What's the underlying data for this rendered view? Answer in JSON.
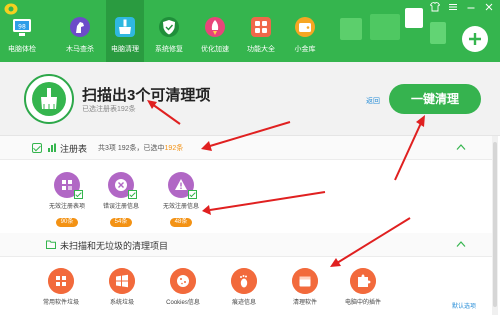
{
  "window": {
    "controls": [
      "shirt-icon",
      "menu-icon",
      "minimize-icon",
      "close-icon"
    ]
  },
  "tabs": [
    {
      "label": "电脑体检",
      "icon": "monitor-icon"
    },
    {
      "label": "木马查杀",
      "icon": "horse-icon"
    },
    {
      "label": "电脑清理",
      "icon": "broom-icon",
      "active": true
    },
    {
      "label": "系统修复",
      "icon": "shield-icon"
    },
    {
      "label": "优化加速",
      "icon": "rocket-icon"
    },
    {
      "label": "功能大全",
      "icon": "grid-icon"
    },
    {
      "label": "小金库",
      "icon": "wallet-icon"
    }
  ],
  "summary": {
    "title": "扫描出3个可清理项",
    "subtitle": "已选注册表192条",
    "back_link": "返回",
    "clean_button": "一键清理"
  },
  "registry": {
    "title": "注册表",
    "count_prefix": "共3项 192条，已选中",
    "count_highlight": "192条",
    "items": [
      {
        "name": "无效注册表项",
        "badge": "90条",
        "icon": "registry-grid-icon"
      },
      {
        "name": "错误注册信息",
        "badge": "54条",
        "icon": "error-x-icon"
      },
      {
        "name": "无效注册信息",
        "badge": "48条",
        "icon": "warning-icon"
      }
    ]
  },
  "unscanned": {
    "title": "未扫描和无垃圾的清理项目",
    "items": [
      {
        "name": "常用软件垃圾",
        "icon": "app-trash-icon"
      },
      {
        "name": "系统垃圾",
        "icon": "windows-icon"
      },
      {
        "name": "Cookies信息",
        "icon": "cookie-icon"
      },
      {
        "name": "痕迹信息",
        "icon": "footprint-icon"
      },
      {
        "name": "清理软件",
        "icon": "calendar-icon"
      },
      {
        "name": "电脑中的插件",
        "icon": "puzzle-icon"
      }
    ],
    "default_link": "默认选项"
  },
  "colors": {
    "brand_green": "#35b54e",
    "badge_orange": "#f39214",
    "registry_purple": "#b167c5",
    "item_orange": "#f26a3c",
    "annotation_red": "#e02020"
  }
}
